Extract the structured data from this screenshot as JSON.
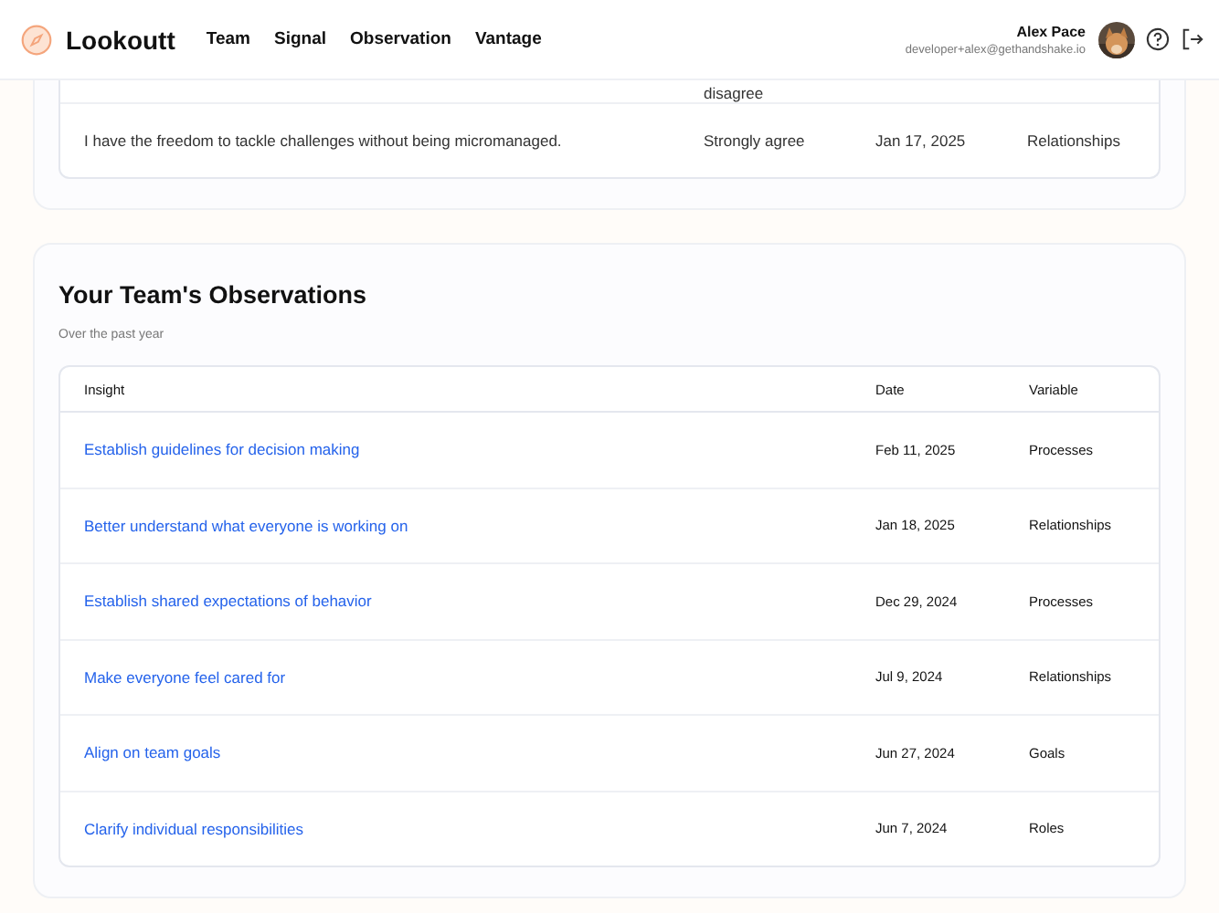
{
  "header": {
    "brand": "Lookoutt",
    "nav": [
      {
        "label": "Team"
      },
      {
        "label": "Signal"
      },
      {
        "label": "Observation"
      },
      {
        "label": "Vantage"
      }
    ],
    "user": {
      "name": "Alex Pace",
      "email": "developer+alex@gethandshake.io"
    }
  },
  "responses": {
    "rows": [
      {
        "statement": "",
        "response": "disagree",
        "date": "",
        "variable": ""
      },
      {
        "statement": "I have the freedom to tackle challenges without being micromanaged.",
        "response": "Strongly agree",
        "date": "Jan 17, 2025",
        "variable": "Relationships"
      }
    ]
  },
  "observations": {
    "title": "Your Team's Observations",
    "subtitle": "Over the past year",
    "columns": [
      "Insight",
      "Date",
      "Variable"
    ],
    "rows": [
      {
        "insight": "Establish guidelines for decision making",
        "date": "Feb 11, 2025",
        "variable": "Processes"
      },
      {
        "insight": "Better understand what everyone is working on",
        "date": "Jan 18, 2025",
        "variable": "Relationships"
      },
      {
        "insight": "Establish shared expectations of behavior",
        "date": "Dec 29, 2024",
        "variable": "Processes"
      },
      {
        "insight": "Make everyone feel cared for",
        "date": "Jul 9, 2024",
        "variable": "Relationships"
      },
      {
        "insight": "Align on team goals",
        "date": "Jun 27, 2024",
        "variable": "Goals"
      },
      {
        "insight": "Clarify individual responsibilities",
        "date": "Jun 7, 2024",
        "variable": "Roles"
      }
    ]
  }
}
